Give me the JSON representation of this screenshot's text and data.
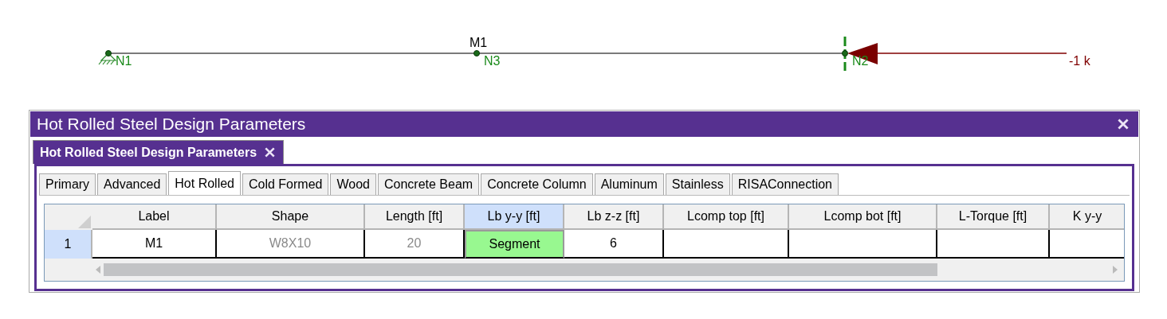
{
  "model": {
    "member_label": "M1",
    "nodes": [
      {
        "label": "N1",
        "kind": "pinned"
      },
      {
        "label": "N3",
        "kind": "free"
      },
      {
        "label": "N2",
        "kind": "restraint"
      }
    ],
    "load_label": "-1 k"
  },
  "window": {
    "title": "Hot Rolled Steel Design Parameters"
  },
  "document_tabs": [
    {
      "label": "Hot Rolled Steel Design Parameters",
      "selected": true
    }
  ],
  "tabs": [
    {
      "label": "Primary",
      "selected": false
    },
    {
      "label": "Advanced",
      "selected": false
    },
    {
      "label": "Hot Rolled",
      "selected": true
    },
    {
      "label": "Cold Formed",
      "selected": false
    },
    {
      "label": "Wood",
      "selected": false
    },
    {
      "label": "Concrete Beam",
      "selected": false
    },
    {
      "label": "Concrete Column",
      "selected": false
    },
    {
      "label": "Aluminum",
      "selected": false
    },
    {
      "label": "Stainless",
      "selected": false
    },
    {
      "label": "RISAConnection",
      "selected": false
    }
  ],
  "table": {
    "columns": [
      {
        "label": "Label",
        "selected": false
      },
      {
        "label": "Shape",
        "selected": false
      },
      {
        "label": "Length [ft]",
        "selected": false
      },
      {
        "label": "Lb y-y [ft]",
        "selected": true
      },
      {
        "label": "Lb z-z [ft]",
        "selected": false
      },
      {
        "label": "Lcomp top [ft]",
        "selected": false
      },
      {
        "label": "Lcomp bot [ft]",
        "selected": false
      },
      {
        "label": "L-Torque [ft]",
        "selected": false
      },
      {
        "label": "K y-y",
        "selected": false
      }
    ],
    "rows": [
      {
        "number": "1",
        "selected": true,
        "cells": [
          {
            "value": "M1",
            "readonly": false,
            "selected": false
          },
          {
            "value": "W8X10",
            "readonly": true,
            "selected": false
          },
          {
            "value": "20",
            "readonly": true,
            "selected": false
          },
          {
            "value": "Segment",
            "readonly": false,
            "selected": true
          },
          {
            "value": "6",
            "readonly": false,
            "selected": false
          },
          {
            "selected": false
          },
          {
            "selected": false
          },
          {
            "selected": false
          },
          {
            "selected": false
          }
        ]
      }
    ]
  }
}
